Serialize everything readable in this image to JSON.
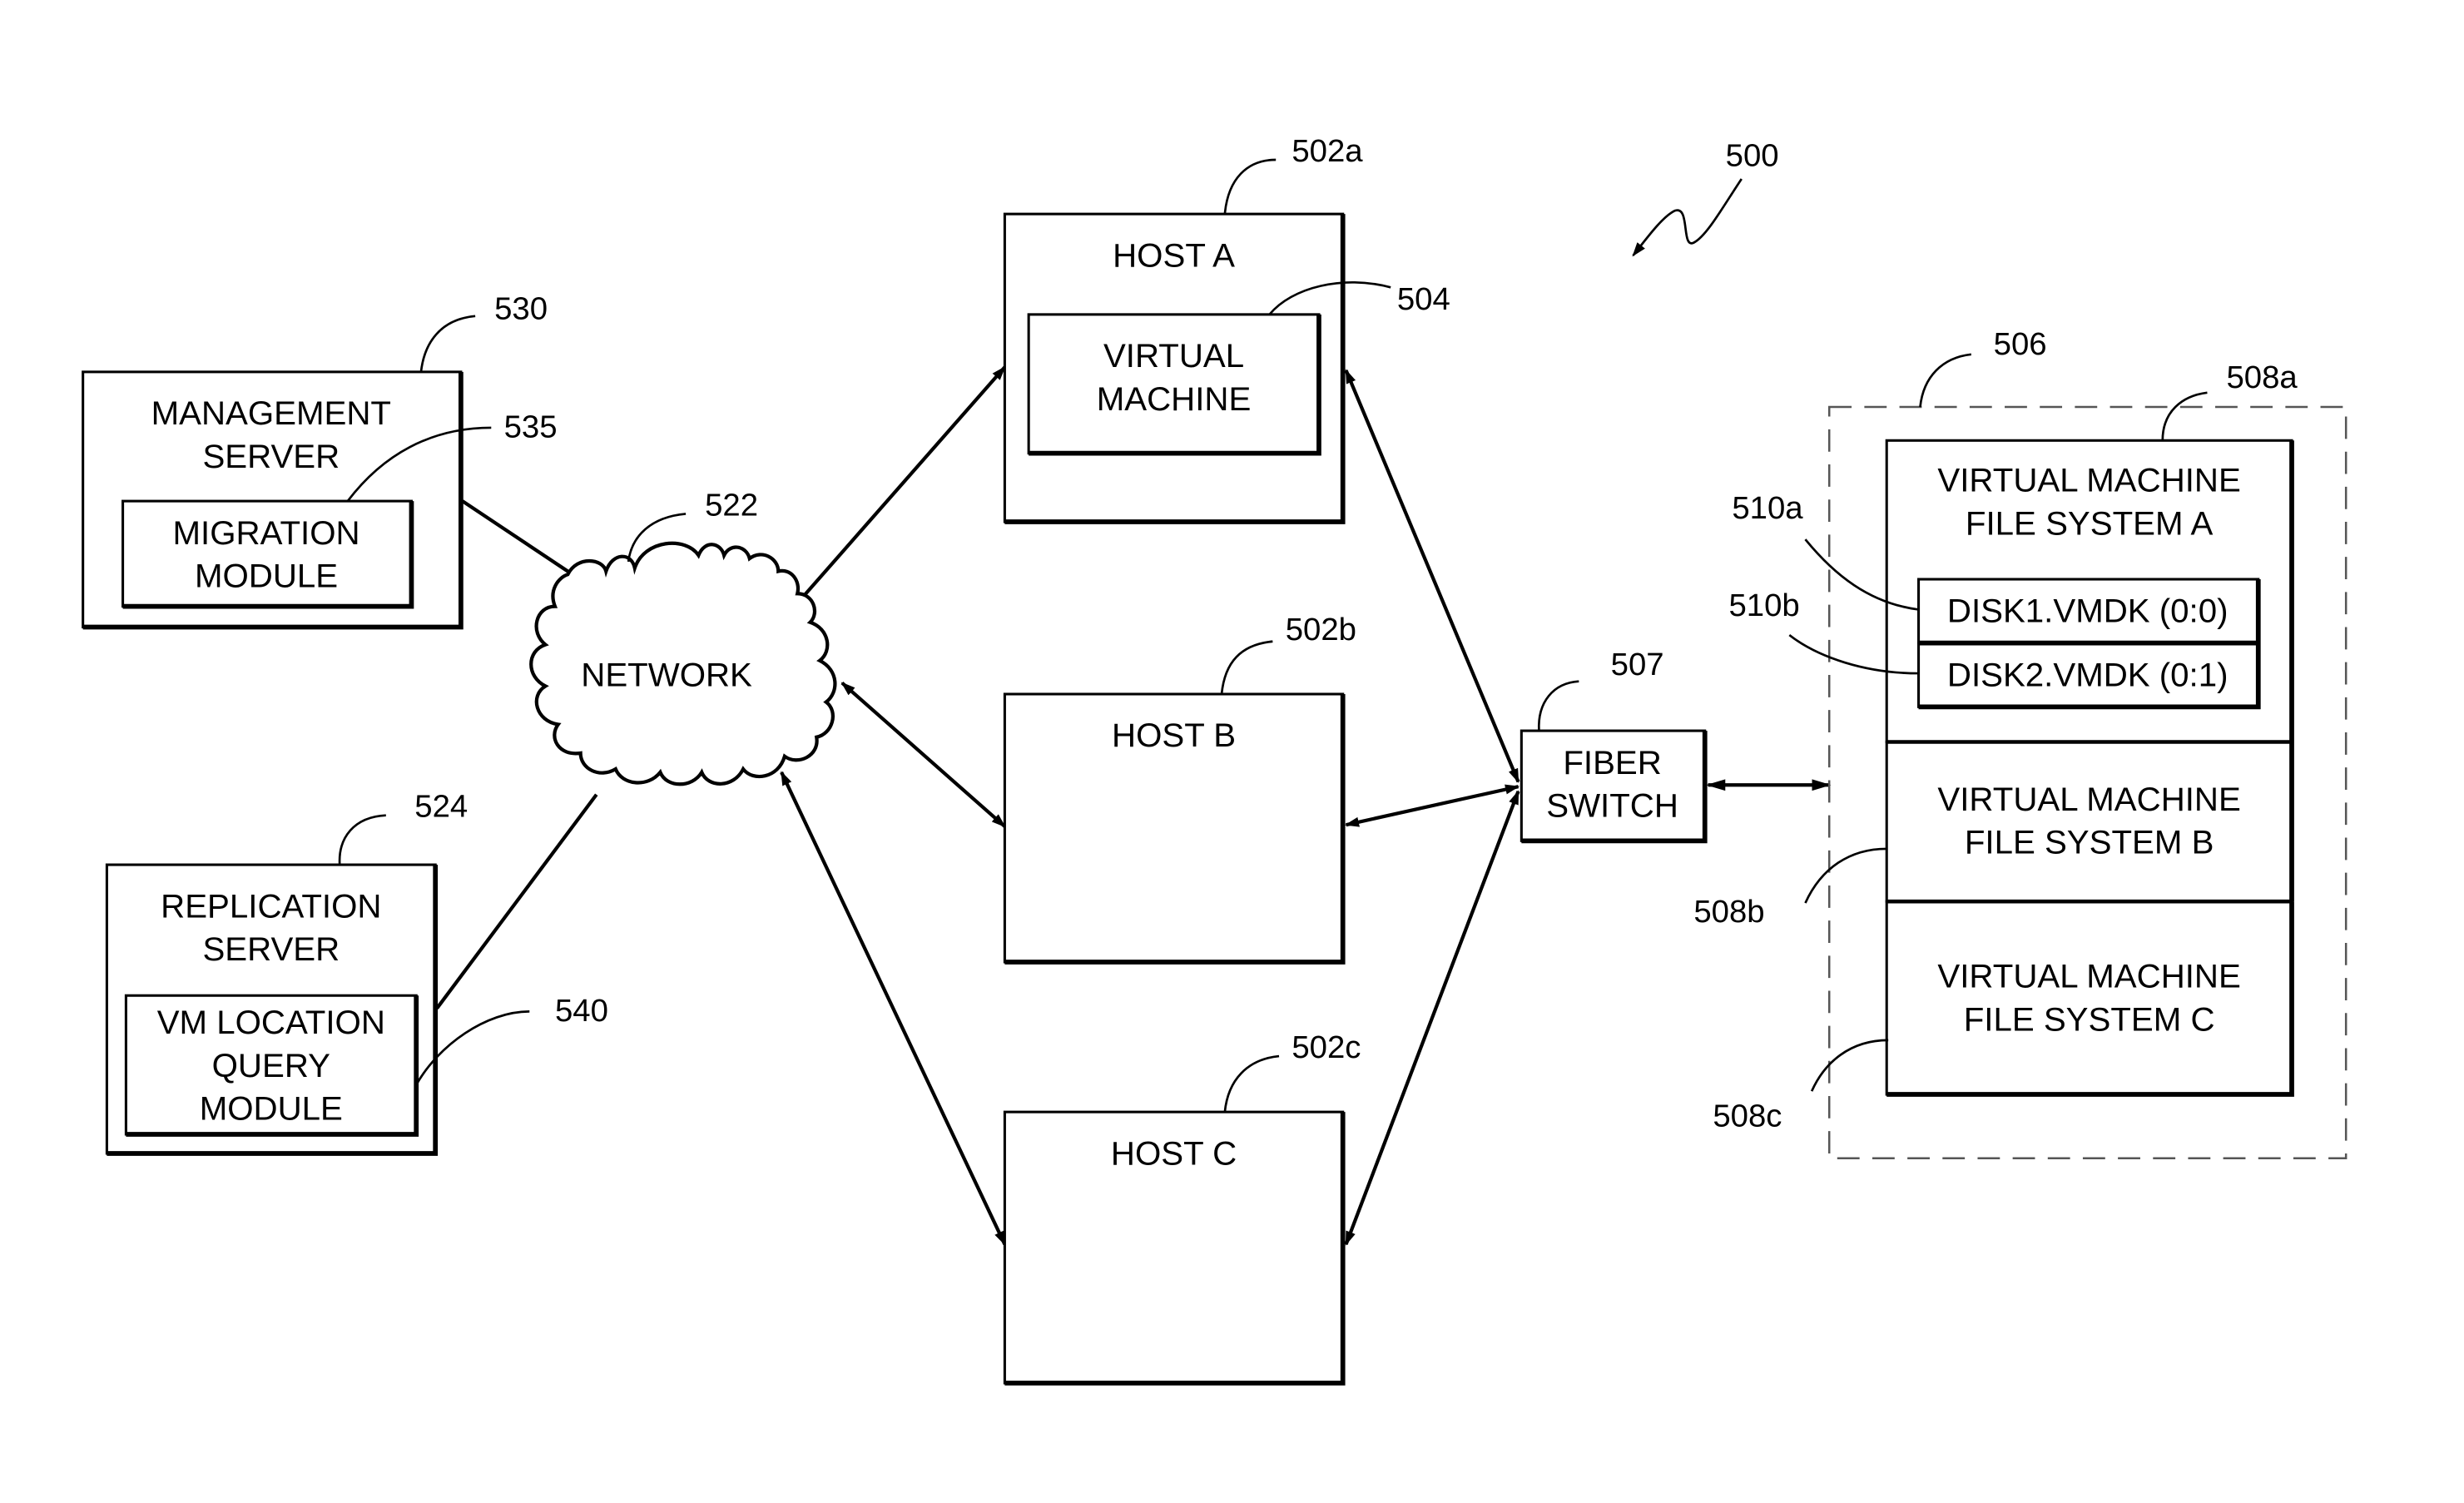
{
  "figure": {
    "ref": "500",
    "nodes": {
      "management_server": {
        "ref": "530",
        "lines": [
          "MANAGEMENT",
          "SERVER"
        ],
        "module": {
          "ref": "535",
          "lines": [
            "MIGRATION",
            "MODULE"
          ]
        }
      },
      "replication_server": {
        "ref": "524",
        "lines": [
          "REPLICATION",
          "SERVER"
        ],
        "module": {
          "ref": "540",
          "lines": [
            "VM LOCATION",
            "QUERY",
            "MODULE"
          ]
        }
      },
      "network": {
        "ref": "522",
        "label": "NETWORK"
      },
      "host_a": {
        "ref": "502a",
        "label": "HOST A",
        "vm": {
          "ref": "504",
          "lines": [
            "VIRTUAL",
            "MACHINE"
          ]
        }
      },
      "host_b": {
        "ref": "502b",
        "label": "HOST B"
      },
      "host_c": {
        "ref": "502c",
        "label": "HOST C"
      },
      "fiber_switch": {
        "ref": "507",
        "lines": [
          "FIBER",
          "SWITCH"
        ]
      },
      "storage": {
        "ref": "506",
        "fs_a": {
          "ref": "508a",
          "lines": [
            "VIRTUAL MACHINE",
            "FILE SYSTEM A"
          ],
          "disks": [
            {
              "ref": "510a",
              "label": "DISK1.VMDK (0:0)"
            },
            {
              "ref": "510b",
              "label": "DISK2.VMDK (0:1)"
            }
          ]
        },
        "fs_b": {
          "ref": "508b",
          "lines": [
            "VIRTUAL MACHINE",
            "FILE SYSTEM B"
          ]
        },
        "fs_c": {
          "ref": "508c",
          "lines": [
            "VIRTUAL MACHINE",
            "FILE SYSTEM C"
          ]
        }
      }
    }
  }
}
